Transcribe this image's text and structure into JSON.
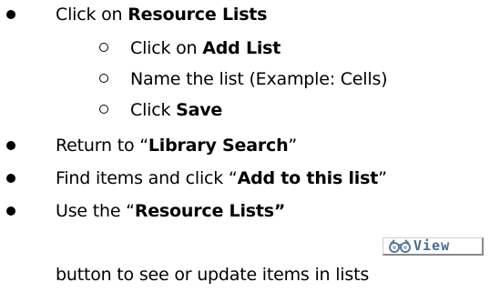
{
  "document": {
    "items": [
      {
        "level": 1,
        "parts": [
          {
            "text": "Click on ",
            "bold": false
          },
          {
            "text": "Resource Lists",
            "bold": true
          }
        ]
      },
      {
        "level": 2,
        "parts": [
          {
            "text": "Click on ",
            "bold": false
          },
          {
            "text": "Add List",
            "bold": true
          }
        ]
      },
      {
        "level": 2,
        "parts": [
          {
            "text": "Name the list (Example: Cells)",
            "bold": false
          }
        ]
      },
      {
        "level": 2,
        "parts": [
          {
            "text": "Click ",
            "bold": false
          },
          {
            "text": "Save",
            "bold": true
          }
        ]
      },
      {
        "level": 1,
        "parts": [
          {
            "text": "Return to “",
            "bold": false
          },
          {
            "text": "Library Search",
            "bold": true
          },
          {
            "text": "”",
            "bold": false
          }
        ]
      },
      {
        "level": 1,
        "parts": [
          {
            "text": "Find items and click “",
            "bold": false
          },
          {
            "text": "Add to this list",
            "bold": true
          },
          {
            "text": "”",
            "bold": false
          }
        ]
      },
      {
        "level": 1,
        "parts": [
          {
            "text": "Use the “",
            "bold": false
          },
          {
            "text": "Resource Lists”",
            "bold": true
          }
        ]
      },
      {
        "level": 0,
        "parts": [
          {
            "text": "button to see or update items in lists",
            "bold": false
          }
        ]
      }
    ],
    "view_button": {
      "label": "View",
      "icon": "binoculars-icon",
      "text_color": "#4a6d8c"
    }
  }
}
